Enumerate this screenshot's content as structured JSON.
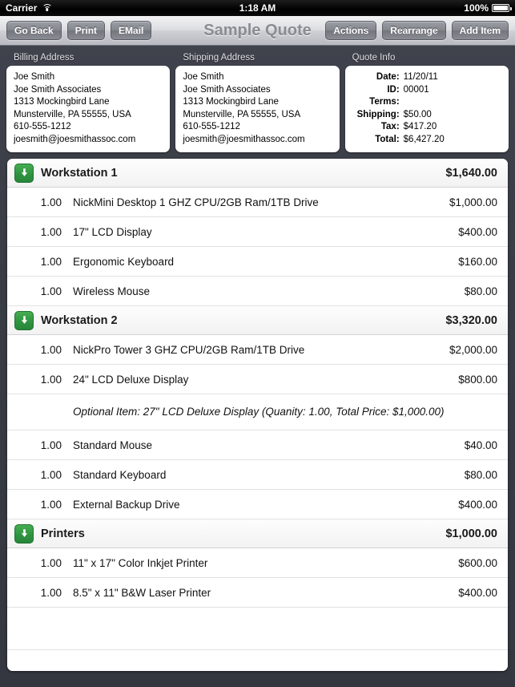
{
  "status_bar": {
    "carrier": "Carrier",
    "wifi_icon": "wifi-icon",
    "time": "1:18 AM",
    "battery_percent": "100%",
    "battery_icon": "battery-full-icon"
  },
  "toolbar": {
    "title": "Sample Quote",
    "left_buttons": [
      {
        "label": "Go Back",
        "name": "go-back-button"
      },
      {
        "label": "Print",
        "name": "print-button"
      },
      {
        "label": "EMail",
        "name": "email-button"
      }
    ],
    "right_buttons": [
      {
        "label": "Actions",
        "name": "actions-button"
      },
      {
        "label": "Rearrange",
        "name": "rearrange-button"
      },
      {
        "label": "Add Item",
        "name": "add-item-button"
      }
    ]
  },
  "billing_address": {
    "title": "Billing Address",
    "lines": [
      "Joe Smith",
      "Joe Smith Associates",
      "1313 Mockingbird Lane",
      "Munsterville, PA 55555, USA",
      "610-555-1212",
      "joesmith@joesmithassoc.com"
    ]
  },
  "shipping_address": {
    "title": "Shipping Address",
    "lines": [
      "Joe Smith",
      "Joe Smith Associates",
      "1313 Mockingbird Lane",
      "Munsterville, PA 55555, USA",
      "610-555-1212",
      "joesmith@joesmithassoc.com"
    ]
  },
  "quote_info": {
    "title": "Quote Info",
    "rows": [
      {
        "label": "Date:",
        "value": "11/20/11"
      },
      {
        "label": "ID:",
        "value": "00001"
      },
      {
        "label": "Terms:",
        "value": ""
      },
      {
        "label": "Shipping:",
        "value": "$50.00"
      },
      {
        "label": "Tax:",
        "value": "$417.20"
      },
      {
        "label": "Total:",
        "value": "$6,427.20"
      }
    ]
  },
  "groups": [
    {
      "name": "Workstation 1",
      "total": "$1,640.00",
      "disclosure_icon": "arrow-down-icon",
      "items": [
        {
          "qty": "1.00",
          "desc": "NickMini Desktop 1 GHZ CPU/2GB Ram/1TB Drive",
          "price": "$1,000.00"
        },
        {
          "qty": "1.00",
          "desc": "17\" LCD Display",
          "price": "$400.00"
        },
        {
          "qty": "1.00",
          "desc": "Ergonomic Keyboard",
          "price": "$160.00"
        },
        {
          "qty": "1.00",
          "desc": "Wireless Mouse",
          "price": "$80.00"
        }
      ]
    },
    {
      "name": "Workstation 2",
      "total": "$3,320.00",
      "disclosure_icon": "arrow-down-icon",
      "items": [
        {
          "qty": "1.00",
          "desc": "NickPro Tower 3 GHZ CPU/2GB Ram/1TB Drive",
          "price": "$2,000.00"
        },
        {
          "qty": "1.00",
          "desc": "24\" LCD Deluxe Display",
          "price": "$800.00"
        },
        {
          "optional_text": "Optional Item: 27\" LCD Deluxe Display (Quanity: 1.00, Total Price: $1,000.00)"
        },
        {
          "qty": "1.00",
          "desc": "Standard Mouse",
          "price": "$40.00"
        },
        {
          "qty": "1.00",
          "desc": "Standard Keyboard",
          "price": "$80.00"
        },
        {
          "qty": "1.00",
          "desc": "External Backup Drive",
          "price": "$400.00"
        }
      ]
    },
    {
      "name": "Printers",
      "total": "$1,000.00",
      "disclosure_icon": "arrow-down-icon",
      "items": [
        {
          "qty": "1.00",
          "desc": "11\" x 17\" Color Inkjet Printer",
          "price": "$600.00"
        },
        {
          "qty": "1.00",
          "desc": "8.5\" x 11\" B&W Laser Printer",
          "price": "$400.00"
        }
      ]
    }
  ],
  "empty_rows": 2,
  "colors": {
    "background": "#393c45",
    "disclosure_green": "#2f9440",
    "toolbar_title": "#8a8c93",
    "panel_white": "#ffffff"
  }
}
